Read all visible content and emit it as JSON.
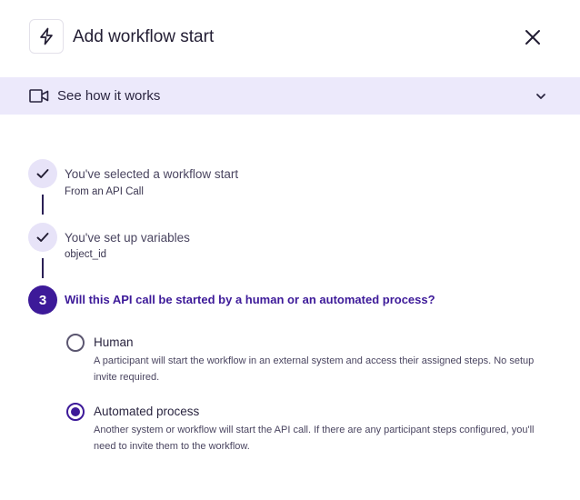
{
  "header": {
    "icon": "lightning-bolt-icon",
    "title": "Add workflow start",
    "close_icon": "close-icon"
  },
  "how_it_works": {
    "icon": "video-camera-icon",
    "label": "See how it works",
    "chevron_icon": "chevron-down-icon",
    "background": "#ece9fb"
  },
  "steps": [
    {
      "state": "done",
      "icon": "checkmark-icon",
      "title": "You've selected a workflow start",
      "subtitle": "From an API Call"
    },
    {
      "state": "done",
      "icon": "checkmark-icon",
      "title": "You've set up variables",
      "subtitle": "object_id"
    },
    {
      "state": "active",
      "number": "3",
      "question": "Will this API call be started by a human or an automated process?"
    }
  ],
  "options": [
    {
      "label": "Human",
      "selected": false,
      "description": "A participant will start the workflow in an external system and access their assigned steps. No setup invite required."
    },
    {
      "label": "Automated process",
      "selected": true,
      "description": "Another system or workflow will start the API call. If there are any participant steps configured, you'll need to invite them to the workflow."
    }
  ],
  "colors": {
    "accent": "#3d1a99",
    "done_circle": "#e7e3f8",
    "banner": "#ece9fb"
  }
}
